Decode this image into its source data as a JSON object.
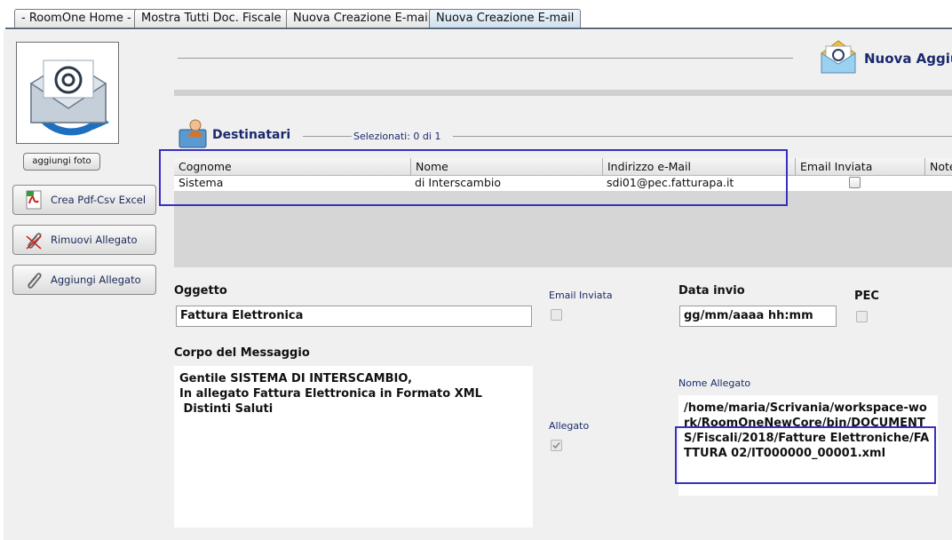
{
  "tabs": [
    {
      "label": "- RoomOne Home -"
    },
    {
      "label": "Mostra Tutti Doc. Fiscale"
    },
    {
      "label": "Nuova Creazione E-mail"
    },
    {
      "label": "Nuova Creazione E-mail"
    }
  ],
  "sidebar": {
    "add_photo": "aggiungi foto",
    "buttons": [
      {
        "label": "Crea Pdf-Csv Excel",
        "icon": "pdf-icon"
      },
      {
        "label": "Rimuovi Allegato",
        "icon": "paperclip-remove-icon"
      },
      {
        "label": "Aggiungi Allegato",
        "icon": "paperclip-icon"
      }
    ]
  },
  "header": {
    "title": "Nuova Aggiu"
  },
  "recipients": {
    "title": "Destinatari",
    "selected": "Selezionati:  0 di 1",
    "columns": [
      "Cognome",
      "Nome",
      "Indirizzo e-Mail",
      "Email Inviata",
      "Note"
    ],
    "rows": [
      {
        "cognome": "Sistema",
        "nome": "di Interscambio",
        "email": "sdi01@pec.fatturapa.it",
        "inviata": false
      }
    ]
  },
  "form": {
    "subject_label": "Oggetto",
    "subject_value": "Fattura Elettronica",
    "email_sent_label": "Email Inviata",
    "date_label": "Data invio",
    "date_value": "gg/mm/aaaa hh:mm",
    "pec_label": "PEC",
    "body_label": "Corpo del Messaggio",
    "body_value": "Gentile SISTEMA DI INTERSCAMBIO,\nIn allegato Fattura Elettronica in Formato XML\n Distinti Saluti",
    "attachment_label": "Allegato",
    "attachment_checked": true,
    "attachment_name_label": "Nome Allegato",
    "attachment_name_value": "/home/maria/Scrivania/workspace-work/RoomOneNewCore/bin/DOCUMENTS/Fiscali/2018/Fatture Elettroniche/FATTURA 02/IT000000_00001.xml"
  },
  "colors": {
    "highlight": "#3a2fc0",
    "title_blue": "#1a2a6e"
  }
}
